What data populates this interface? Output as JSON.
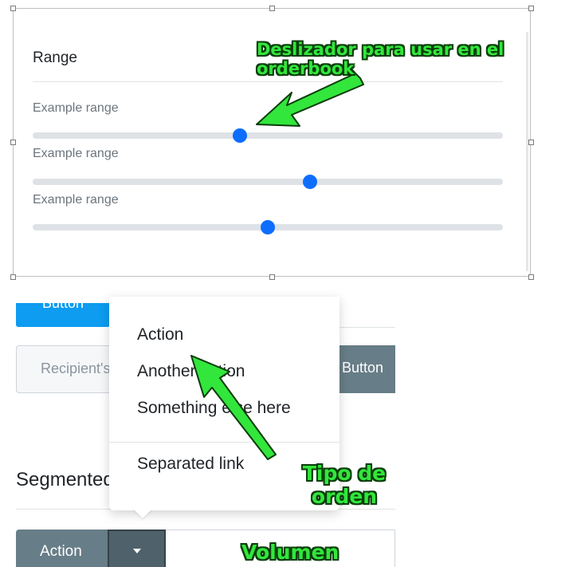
{
  "range_panel": {
    "title": "Range",
    "sliders": [
      {
        "label": "Example range",
        "value": 44
      },
      {
        "label": "Example range",
        "value": 59
      },
      {
        "label": "Example range",
        "value": 50
      }
    ]
  },
  "buttons": {
    "top_partial": "Button",
    "input_group_button": "Button",
    "split_action": "Action"
  },
  "recipient_input": {
    "placeholder": "Recipient's"
  },
  "section": {
    "title": "Segmented buttons"
  },
  "dropdown": {
    "items": [
      "Action",
      "Another action",
      "Something else here"
    ],
    "separated": "Separated link"
  },
  "annotations": {
    "slider_note": "Deslizador para usar en el orderbook",
    "order_type_note": "Tipo de orden",
    "volume_note": "Volumen"
  },
  "colors": {
    "slider_thumb": "#0d6efd",
    "blue_button": "#0d9cf0",
    "gray_button": "#677d87",
    "annotation_green": "#32e63c"
  }
}
